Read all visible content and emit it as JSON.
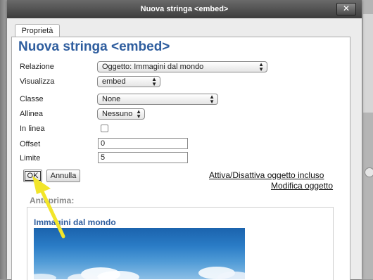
{
  "dialog": {
    "title": "Nuova stringa <embed>",
    "close_symbol": "✕",
    "tab_label": "Proprietà",
    "heading": "Nuova stringa <embed>"
  },
  "form": {
    "relazione": {
      "label": "Relazione",
      "value": "Oggetto: Immagini dal mondo"
    },
    "visualizza": {
      "label": "Visualizza",
      "value": "embed"
    },
    "classe": {
      "label": "Classe",
      "value": "None"
    },
    "allinea": {
      "label": "Allinea",
      "value": "Nessuno"
    },
    "in_linea": {
      "label": "In linea",
      "checked": false
    },
    "offset": {
      "label": "Offset",
      "value": "0"
    },
    "limite": {
      "label": "Limite",
      "value": "5"
    }
  },
  "buttons": {
    "ok": "OK",
    "annulla": "Annulla"
  },
  "links": {
    "toggle": "Attiva/Disattiva oggetto incluso",
    "edit": "Modifica oggetto"
  },
  "preview": {
    "label": "Anteprima:",
    "title": "Immagini dal mondo"
  },
  "colors": {
    "heading": "#2e5d9e",
    "annotation_arrow": "#f2e52a"
  },
  "icons": {
    "close": "close-icon",
    "select_arrows": "updown-chevron-icon",
    "pointer": "yellow-arrow-icon"
  }
}
